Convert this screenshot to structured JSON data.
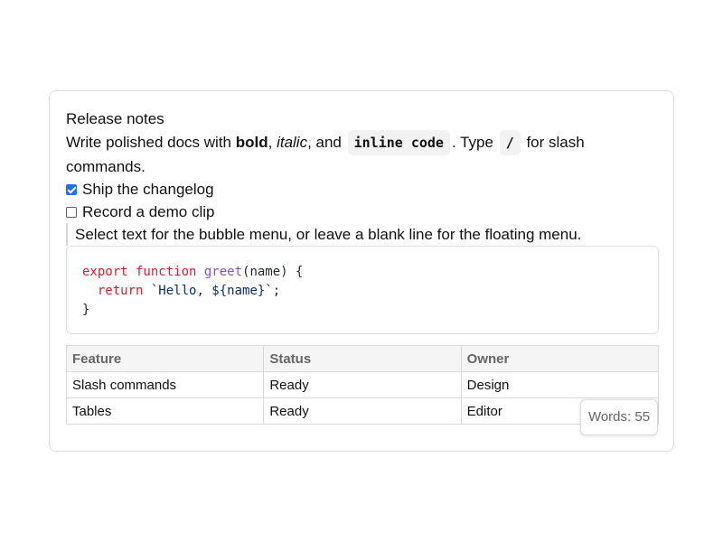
{
  "editor": {
    "title": "Release notes",
    "intro": {
      "part1": "Write polished docs with ",
      "bold": "bold",
      "comma1": ", ",
      "italic": "italic",
      "part2": ", and ",
      "inline_code": "inline code",
      "part3": ". Type ",
      "slash_code": "/",
      "part4": " for slash commands."
    },
    "tasks": [
      {
        "label": "Ship the changelog",
        "checked": true
      },
      {
        "label": "Record a demo clip",
        "checked": false
      }
    ],
    "quote": "Select text for the bubble menu, or leave a blank line for the floating menu.",
    "code": {
      "line1_kw": "export function ",
      "line1_fn": "greet",
      "line1_rest": "(name) {",
      "line2_indent": "  ",
      "line2_kw": "return ",
      "line2_str": "`Hello, ${name}`",
      "line2_end": ";",
      "line3": "}"
    },
    "table": {
      "headers": [
        "Feature",
        "Status",
        "Owner"
      ],
      "rows": [
        [
          "Slash commands",
          "Ready",
          "Design"
        ],
        [
          "Tables",
          "Ready",
          "Editor"
        ]
      ]
    },
    "word_count": "Words: 55"
  },
  "colors": {
    "accent": "#1a73e8",
    "code_keyword": "#cf222e",
    "code_function": "#8250df",
    "code_string": "#0a3069"
  }
}
